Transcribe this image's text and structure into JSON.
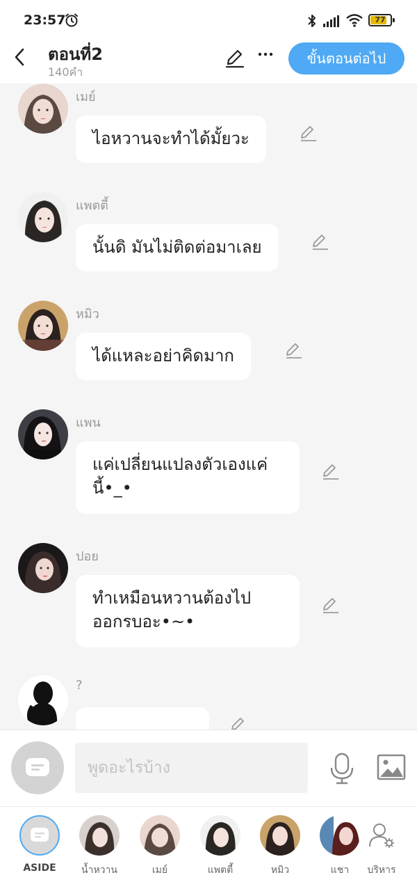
{
  "status_bar": {
    "time": "23:57",
    "battery": "77"
  },
  "header": {
    "title": "ตอนที่2",
    "word_count": "140คำ",
    "next_button": "ขั้นตอนต่อไป"
  },
  "messages": [
    {
      "name": "เมย์",
      "text": "ไอหวานจะทำได้มั้ยวะ"
    },
    {
      "name": "แพตตี้",
      "text": "นั้นดิ มันไม่ติดต่อมาเลย"
    },
    {
      "name": "หมิว",
      "text": "ได้แหละอย่าคิดมาก"
    },
    {
      "name": "แพน",
      "line1": "แค่เปลี่ยนแปลงตัวเองแค่",
      "line2": "นี้•_•"
    },
    {
      "name": "ปอย",
      "line1": "ทำเหมือนหวานต้องไป",
      "line2": "ออกรบอะ•~•"
    },
    {
      "name": "?",
      "text": ""
    }
  ],
  "input": {
    "placeholder": "พูดอะไรบ้าง"
  },
  "characters": [
    {
      "label": "ASIDE"
    },
    {
      "label": "น้ำหวาน"
    },
    {
      "label": "เมย์"
    },
    {
      "label": "แพตตี้"
    },
    {
      "label": "หมิว"
    },
    {
      "label": "แชา"
    },
    {
      "label": "บริหาร"
    }
  ],
  "colors": {
    "accent": "#4fa9f4",
    "background": "#f5f5f5",
    "bubble": "#ffffff",
    "muted_text": "#999999"
  },
  "icons": [
    "back-icon",
    "alarm-icon",
    "bluetooth-icon",
    "signal-icon",
    "wifi-icon",
    "pencil-icon",
    "more-icon",
    "mic-icon",
    "image-icon",
    "chat-bubble-icon",
    "manage-user-icon"
  ]
}
